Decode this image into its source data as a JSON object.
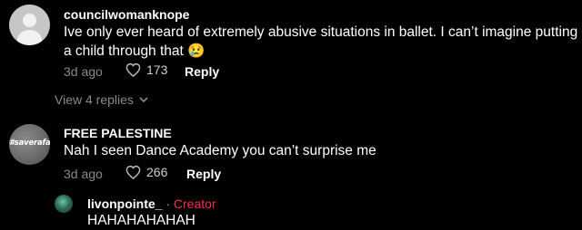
{
  "comments": [
    {
      "username": "councilwomanknope",
      "text_line1": "Ive only ever heard of extremely abusive situations in ballet. I can’t imagine putting",
      "text_line2": "a child through that 😢",
      "time": "3d ago",
      "likes": "173",
      "reply_label": "Reply",
      "view_replies": "View 4 replies"
    },
    {
      "username": "FREE PALESTINE",
      "avatar_text": "#saverafah",
      "text": "Nah I seen Dance Academy you can’t surprise me",
      "time": "3d ago",
      "likes": "266",
      "reply_label": "Reply"
    },
    {
      "username": "livonpointe_",
      "separator": "·",
      "badge": "Creator",
      "text": "HAHAHAHAHAH"
    }
  ],
  "icons": {
    "like": "heart-outline-icon",
    "expand": "chevron-down-icon"
  },
  "colors": {
    "background": "#000000",
    "creator_badge": "#fe2c55",
    "muted": "#8a8a8a"
  }
}
